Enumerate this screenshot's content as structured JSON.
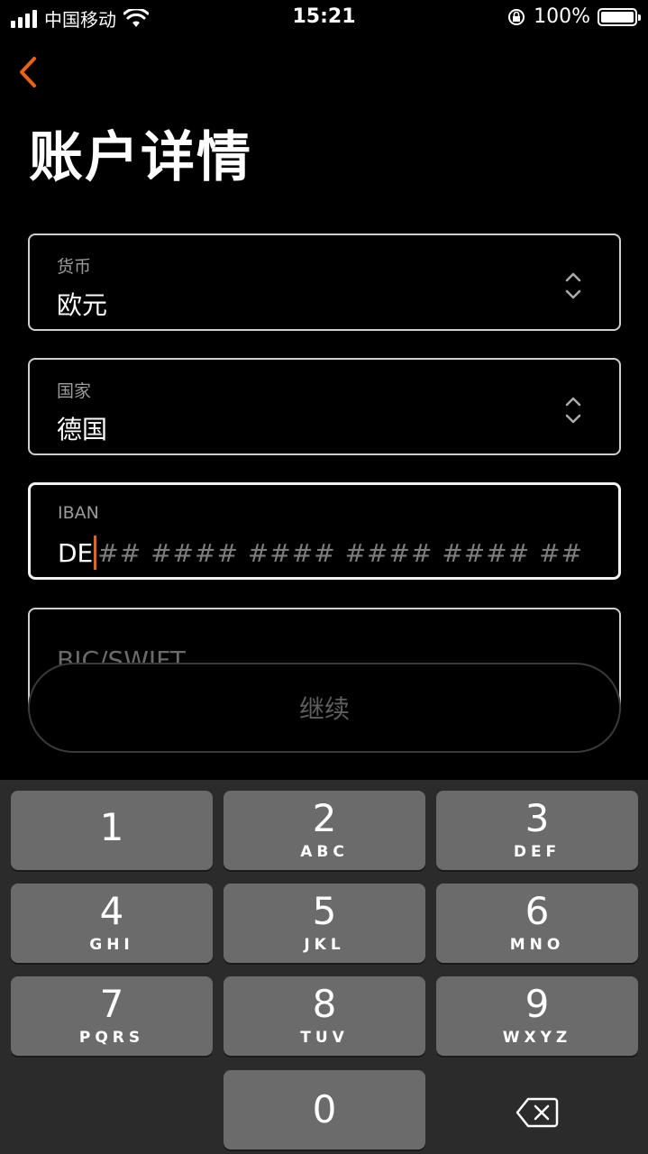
{
  "status_bar": {
    "carrier": "中国移动",
    "time": "15:21",
    "battery": "100%"
  },
  "page": {
    "title": "账户详情"
  },
  "fields": {
    "currency": {
      "label": "货币",
      "value": "欧元"
    },
    "country": {
      "label": "国家",
      "value": "德国"
    },
    "iban": {
      "label": "IBAN",
      "value": "DE",
      "placeholder": "## #### #### #### #### ##"
    },
    "bic": {
      "label": "BIC/SWIFT"
    }
  },
  "continue_label": "继续",
  "keypad": {
    "keys": [
      {
        "num": "1",
        "letters": ""
      },
      {
        "num": "2",
        "letters": "ABC"
      },
      {
        "num": "3",
        "letters": "DEF"
      },
      {
        "num": "4",
        "letters": "GHI"
      },
      {
        "num": "5",
        "letters": "JKL"
      },
      {
        "num": "6",
        "letters": "MNO"
      },
      {
        "num": "7",
        "letters": "PQRS"
      },
      {
        "num": "8",
        "letters": "TUV"
      },
      {
        "num": "9",
        "letters": "WXYZ"
      },
      {
        "num": "0",
        "letters": ""
      }
    ]
  },
  "colors": {
    "accent": "#e8621c",
    "background": "#000000",
    "key": "#6b6b6b",
    "keyboard_bg": "#2b2b2b"
  }
}
